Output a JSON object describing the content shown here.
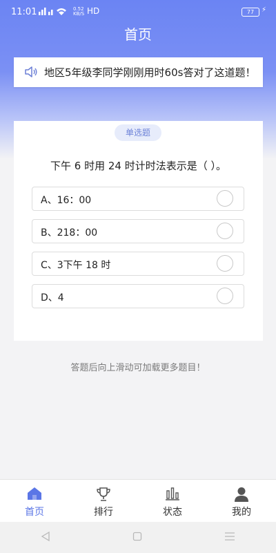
{
  "status_bar": {
    "time": "11:01",
    "network_top": "0.52",
    "network_bottom": "KB/S",
    "network_type": "HD",
    "battery": "77"
  },
  "header": {
    "title": "首页"
  },
  "notice": {
    "message": "地区5年级李同学刚刚用时60s答对了这道题！"
  },
  "question": {
    "type_tag": "单选题",
    "text": "下午 6 时用 24 时计时法表示是（ ）。",
    "options": [
      {
        "label": "A、16：00"
      },
      {
        "label": "B、218：00"
      },
      {
        "label": "C、3下午 18 时"
      },
      {
        "label": "D、4"
      }
    ]
  },
  "hint": "答题后向上滑动可加载更多题目！",
  "tabs": [
    {
      "label": "首页",
      "icon": "home-icon",
      "active": true
    },
    {
      "label": "排行",
      "icon": "trophy-icon",
      "active": false
    },
    {
      "label": "状态",
      "icon": "bar-chart-icon",
      "active": false
    },
    {
      "label": "我的",
      "icon": "user-icon",
      "active": false
    }
  ],
  "colors": {
    "accent": "#5b76e6",
    "header": "#6b84f3",
    "inactive_icon": "#555555"
  }
}
